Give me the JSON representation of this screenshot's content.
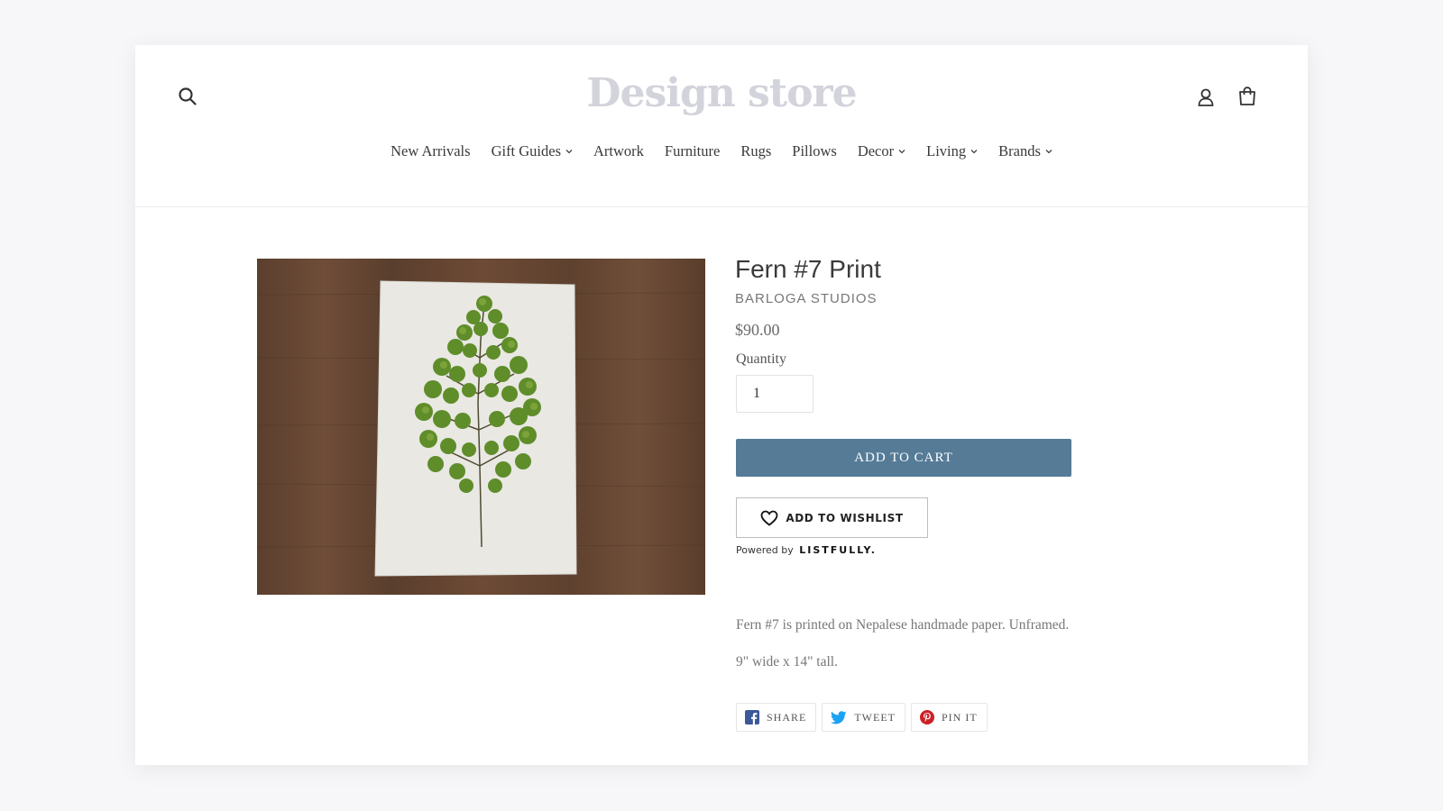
{
  "header": {
    "logo": "Design store",
    "nav": [
      {
        "label": "New Arrivals",
        "has_dropdown": false
      },
      {
        "label": "Gift Guides",
        "has_dropdown": true
      },
      {
        "label": "Artwork",
        "has_dropdown": false
      },
      {
        "label": "Furniture",
        "has_dropdown": false
      },
      {
        "label": "Rugs",
        "has_dropdown": false
      },
      {
        "label": "Pillows",
        "has_dropdown": false
      },
      {
        "label": "Decor",
        "has_dropdown": true
      },
      {
        "label": "Living",
        "has_dropdown": true
      },
      {
        "label": "Brands",
        "has_dropdown": true
      }
    ],
    "icons": [
      "search-icon",
      "user-icon",
      "cart-icon"
    ]
  },
  "product": {
    "title": "Fern #7 Print",
    "vendor": "BARLOGA STUDIOS",
    "price": "$90.00",
    "quantity_label": "Quantity",
    "quantity_value": "1",
    "add_to_cart": "ADD TO CART",
    "wishlist": {
      "label": "ADD TO WISHLIST",
      "powered_by": "Powered by",
      "powered_brand": "LISTFULLY."
    },
    "description": [
      "Fern #7 is printed on Nepalese handmade paper. Unframed.",
      "9\" wide x 14\" tall."
    ]
  },
  "share": [
    {
      "label": "SHARE",
      "icon": "facebook-icon",
      "color": "#3b5998"
    },
    {
      "label": "TWEET",
      "icon": "twitter-icon",
      "color": "#1da1f2"
    },
    {
      "label": "PIN IT",
      "icon": "pinterest-icon",
      "color": "#cb2027"
    }
  ],
  "colors": {
    "accent": "#557b97",
    "logo": "#d3d3dc"
  }
}
